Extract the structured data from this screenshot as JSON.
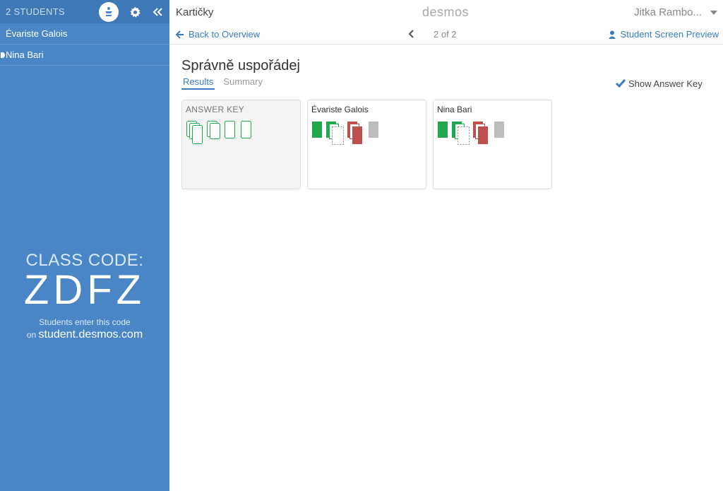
{
  "sidebar": {
    "students_count": "2 STUDENTS",
    "students": [
      {
        "name": "Évariste Galois",
        "selected": false
      },
      {
        "name": "Nina Bari",
        "selected": true
      }
    ],
    "class_code": {
      "label": "CLASS CODE:",
      "value": "ZDFZ",
      "hint": "Students enter this code",
      "url_prefix": "on",
      "url": "student.desmos.com"
    },
    "icons": [
      "pace-icon",
      "gear-icon",
      "collapse-icon"
    ]
  },
  "topbar": {
    "activity_title": "Kartičky",
    "logo": "desmos",
    "user": "Jitka Rambo..."
  },
  "navbar": {
    "back_label": "Back to Overview",
    "pager": "2 of 2",
    "preview_label": "Student Screen Preview"
  },
  "main": {
    "screen_title": "Správně uspořádej",
    "tabs": [
      {
        "label": "Results",
        "active": true
      },
      {
        "label": "Summary",
        "active": false
      }
    ],
    "show_answer_key_label": "Show Answer Key",
    "show_answer_key_checked": true,
    "cards": [
      {
        "title": "ANSWER KEY"
      },
      {
        "title": "Évariste Galois"
      },
      {
        "title": "Nina Bari"
      }
    ]
  },
  "colors": {
    "sidebar": "#4a86c5",
    "link": "#3a7bc1",
    "correct": "#20a84f",
    "incorrect": "#c0504d",
    "missing": "#bdbdbd"
  }
}
